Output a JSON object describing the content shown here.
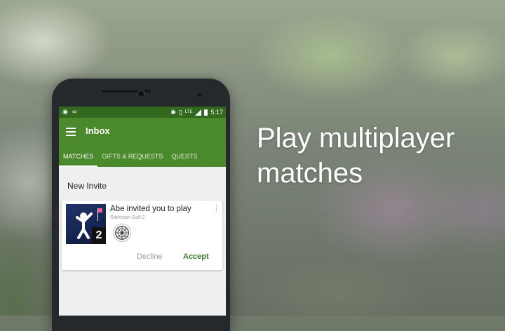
{
  "headline": "Play multiplayer matches",
  "statusbar": {
    "time": "5:17",
    "left_icons": [
      "network-icon",
      "voicemail-icon"
    ],
    "right_icons": [
      "bluetooth-icon",
      "vibrate-icon",
      "signal-icon",
      "battery-icon"
    ],
    "lte_label": "LTE"
  },
  "appbar": {
    "title": "Inbox",
    "tabs": [
      {
        "label": "MATCHES",
        "active": true
      },
      {
        "label": "GIFTS & REQUESTS",
        "active": false
      },
      {
        "label": "QUESTS",
        "active": false
      }
    ]
  },
  "content": {
    "section_title": "New Invite",
    "invite": {
      "title": "Abe invited you to play",
      "game": "Stickman Golf 2",
      "game_badge": "2",
      "decline_label": "Decline",
      "accept_label": "Accept"
    }
  },
  "colors": {
    "appbar": "#4a8a2c",
    "statusbar": "#33691e",
    "accept": "#3d7a26"
  }
}
